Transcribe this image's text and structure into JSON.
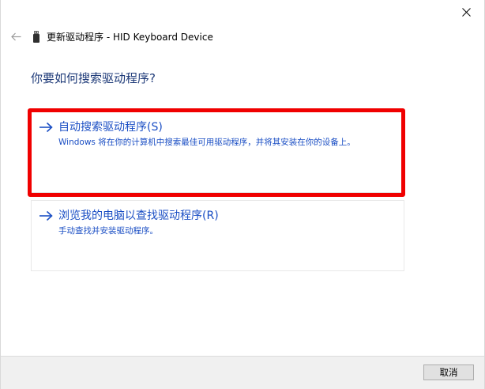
{
  "window": {
    "title": "更新驱动程序 - HID Keyboard Device"
  },
  "main": {
    "heading": "你要如何搜索驱动程序?"
  },
  "options": [
    {
      "title": "自动搜索驱动程序(S)",
      "description": "Windows 将在你的计算机中搜索最佳可用驱动程序，并将其安装在你的设备上。"
    },
    {
      "title": "浏览我的电脑以查找驱动程序(R)",
      "description": "手动查找并安装驱动程序。"
    }
  ],
  "footer": {
    "cancel_label": "取消"
  },
  "icons": {
    "close": "close-icon",
    "back": "back-arrow-icon",
    "device": "usb-device-icon",
    "option_arrow": "right-arrow-icon"
  },
  "colors": {
    "accent_blue": "#1a4ec4",
    "heading_blue": "#1e3a78",
    "highlight_red": "#f00000",
    "footer_bg": "#f0f0f0"
  }
}
